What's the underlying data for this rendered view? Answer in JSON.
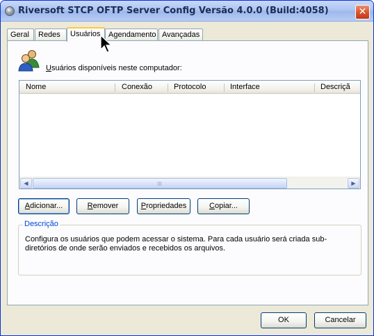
{
  "window": {
    "title": "Riversoft STCP OFTP Server Config Versão 4.0.0 (Build:4058)",
    "close_symbol": "✕"
  },
  "tabs": [
    {
      "label": "Geral",
      "active": false
    },
    {
      "label": "Redes",
      "active": false
    },
    {
      "label": "Usuários",
      "active": true
    },
    {
      "label": "Agendamento",
      "active": false
    },
    {
      "label": "Avançadas",
      "active": false
    }
  ],
  "users_section": {
    "icon": "users-icon",
    "label_mnemonic": "U",
    "label_rest": "suários disponíveis neste computador:"
  },
  "list": {
    "columns": [
      "Nome",
      "Conexão",
      "Protocolo",
      "Interface",
      "Descriçã"
    ],
    "rows": [],
    "scroll_left_symbol": "◀",
    "scroll_right_symbol": "▶",
    "scroll_grip": "III"
  },
  "actions": {
    "add": {
      "mnemonic": "A",
      "rest": "dicionar..."
    },
    "remove": {
      "mnemonic": "R",
      "rest": "emover"
    },
    "properties": {
      "mnemonic": "P",
      "rest": "ropriedades"
    },
    "copy": {
      "mnemonic": "C",
      "rest": "opiar..."
    }
  },
  "description": {
    "legend": "Descrição",
    "text": "Configura os usuários que podem acessar o sistema. Para cada usuário será criada sub-diretórios de onde serão enviados e recebidos os arquivos."
  },
  "footer": {
    "ok_label": "OK",
    "cancel_label": "Cancelar"
  },
  "colors": {
    "title_bar": "#aec5f2",
    "close_button": "#d6522d",
    "active_tab_highlight": "#ffc73c",
    "group_legend": "#0046d5"
  }
}
